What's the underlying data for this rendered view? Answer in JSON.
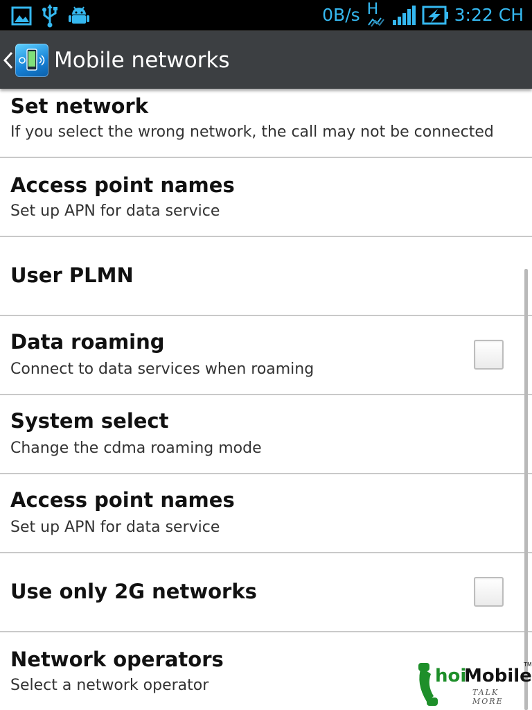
{
  "status_bar": {
    "speed": "0B/s",
    "network_type": "H",
    "time": "3:22 CH",
    "icons": [
      "gallery-icon",
      "usb-icon",
      "android-debug-icon",
      "data-transfer-icon",
      "signal-icon",
      "battery-charging-icon"
    ]
  },
  "action_bar": {
    "title": "Mobile networks",
    "back_icon": "chevron-left-icon",
    "app_icon": "mobile-networks-icon"
  },
  "items": [
    {
      "title": "Set network",
      "summary": "If you select the wrong network, the call may not be connected"
    },
    {
      "title": "Access point names",
      "summary": "Set up APN for data service"
    },
    {
      "title": "User PLMN",
      "summary": ""
    },
    {
      "title": "Data roaming",
      "summary": "Connect to data services when roaming",
      "checked": false
    },
    {
      "title": "System select",
      "summary": "Change the cdma roaming mode"
    },
    {
      "title": "Access point names",
      "summary": "Set up APN for data service"
    },
    {
      "title": "Use only 2G networks",
      "summary": "",
      "checked": false
    },
    {
      "title": "Network operators",
      "summary": "Select a network operator"
    }
  ],
  "watermark": {
    "brand_prefix": "C",
    "brand_mid": "hoi",
    "brand_end": "Mobile",
    "tm": "TM",
    "slogan": "TALK MORE"
  },
  "colors": {
    "status_accent": "#35b8f0",
    "action_bar_bg": "#3c3f42",
    "divider": "#c9c9c9",
    "watermark_green": "#1e8f2a"
  }
}
